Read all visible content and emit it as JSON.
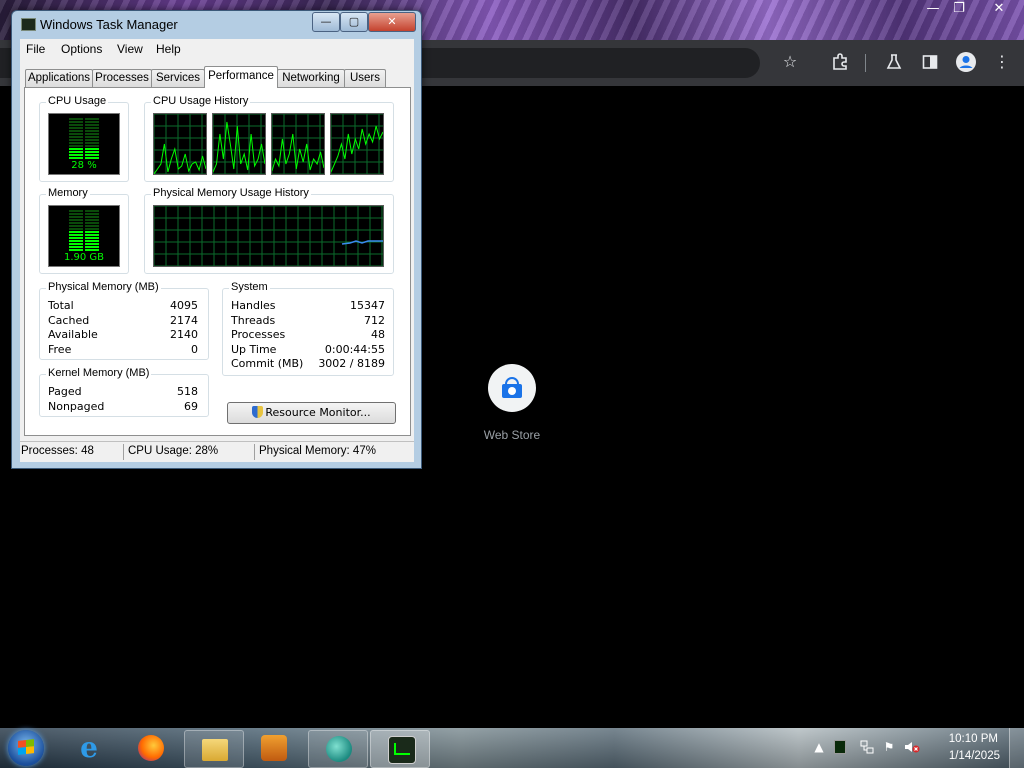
{
  "browser": {
    "window_controls": {
      "minimize": "—",
      "restore": "❐",
      "close": "✕"
    },
    "toolbar_icons": [
      "star-icon",
      "extensions-icon",
      "labs-icon",
      "side-panel-icon",
      "profile-icon",
      "menu-icon"
    ],
    "new_tab": {
      "shortcut_label": "Web Store"
    }
  },
  "task_manager": {
    "title": "Windows Task Manager",
    "caption_buttons": {
      "minimize": "—",
      "maximize": "▢",
      "close": "✕"
    },
    "menu": [
      "File",
      "Options",
      "View",
      "Help"
    ],
    "tabs": [
      "Applications",
      "Processes",
      "Services",
      "Performance",
      "Networking",
      "Users"
    ],
    "active_tab": "Performance",
    "cpu_usage": {
      "label": "CPU Usage",
      "value": "28 %",
      "percent": 28
    },
    "cpu_history": {
      "label": "CPU Usage History"
    },
    "memory": {
      "label": "Memory",
      "value": "1.90 GB",
      "percent": 47
    },
    "memory_history": {
      "label": "Physical Memory Usage History"
    },
    "physical_memory": {
      "title": "Physical Memory (MB)",
      "rows": [
        {
          "label": "Total",
          "value": "4095"
        },
        {
          "label": "Cached",
          "value": "2174"
        },
        {
          "label": "Available",
          "value": "2140"
        },
        {
          "label": "Free",
          "value": "0"
        }
      ]
    },
    "kernel_memory": {
      "title": "Kernel Memory (MB)",
      "rows": [
        {
          "label": "Paged",
          "value": "518"
        },
        {
          "label": "Nonpaged",
          "value": "69"
        }
      ]
    },
    "system": {
      "title": "System",
      "rows": [
        {
          "label": "Handles",
          "value": "15347"
        },
        {
          "label": "Threads",
          "value": "712"
        },
        {
          "label": "Processes",
          "value": "48"
        },
        {
          "label": "Up Time",
          "value": "0:00:44:55"
        },
        {
          "label": "Commit (MB)",
          "value": "3002 / 8189"
        }
      ]
    },
    "resource_monitor_button": "Resource Monitor...",
    "status": {
      "processes": "Processes: 48",
      "cpu": "CPU Usage: 28%",
      "memory": "Physical Memory: 47%"
    }
  },
  "taskbar": {
    "apps": [
      "internet-explorer-icon",
      "firefox-icon",
      "windows-explorer-icon",
      "media-player-icon",
      "browser-icon",
      "task-manager-icon"
    ],
    "clock": {
      "time": "10:10 PM",
      "date": "1/14/2025"
    }
  }
}
